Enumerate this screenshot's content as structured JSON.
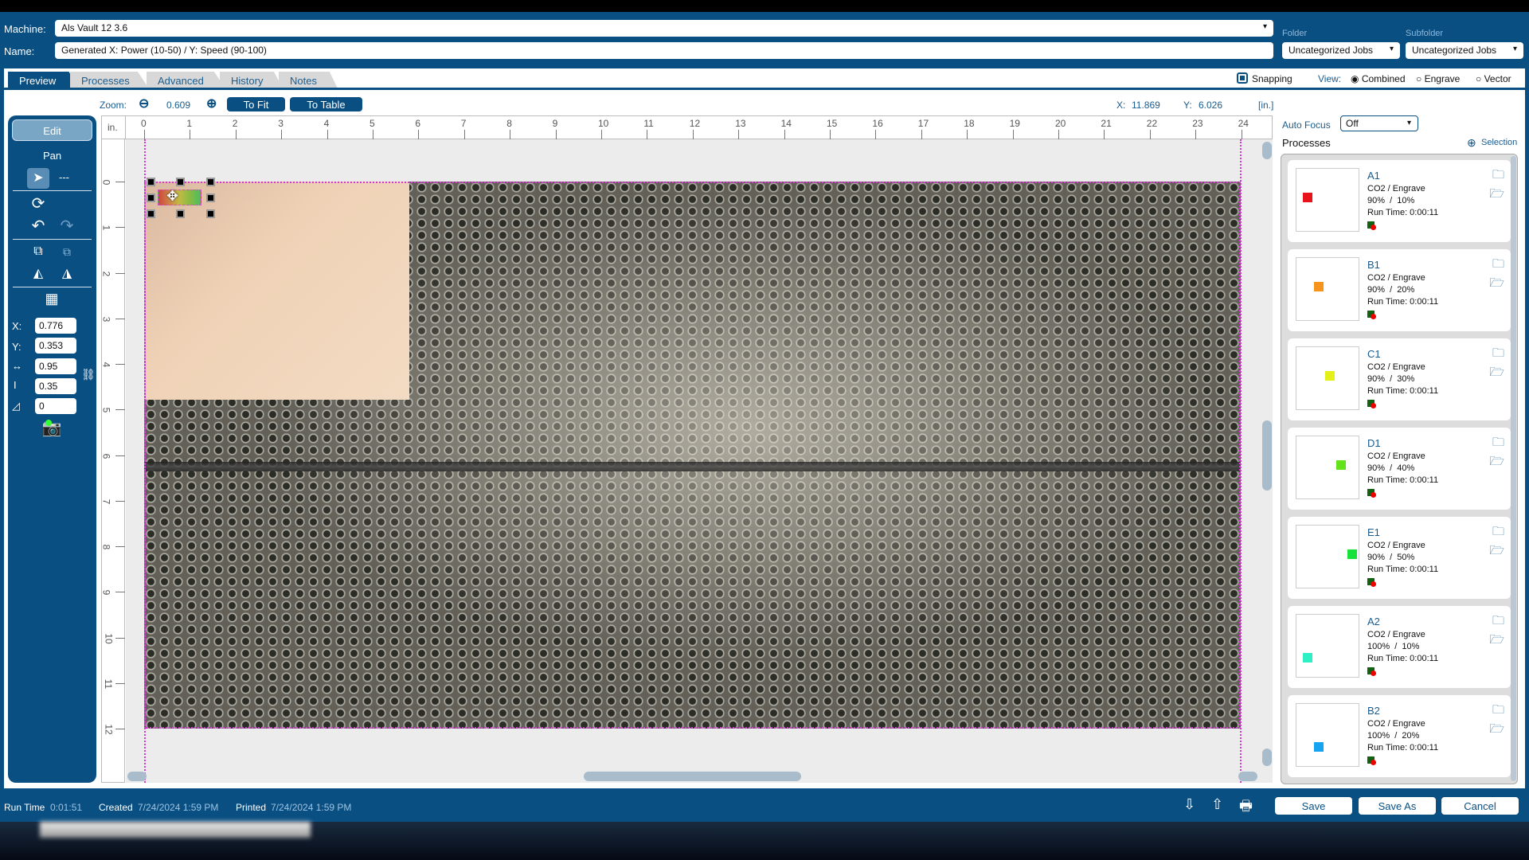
{
  "header": {
    "machine_label": "Machine:",
    "machine_value": "Als Vault 12 3.6",
    "name_label": "Name:",
    "name_value": "Generated X: Power (10-50) / Y: Speed (90-100)",
    "folder_label": "Folder",
    "folder_value": "Uncategorized Jobs",
    "subfolder_label": "Subfolder",
    "subfolder_value": "Uncategorized Jobs"
  },
  "tabs": [
    "Preview",
    "Processes",
    "Advanced",
    "History",
    "Notes"
  ],
  "view": {
    "snapping_label": "Snapping",
    "snapping_checked": true,
    "view_label": "View:",
    "options": [
      "Combined",
      "Engrave",
      "Vector"
    ],
    "selected": "Combined"
  },
  "zoom": {
    "label": "Zoom:",
    "value": "0.609",
    "to_fit": "To Fit",
    "to_table": "To Table"
  },
  "cursor": {
    "x_label": "X:",
    "x": "11.869",
    "y_label": "Y:",
    "y": "6.026",
    "unit": "[in.]"
  },
  "toolbar": {
    "edit": "Edit",
    "pan": "Pan",
    "dash": "---",
    "x_label": "X:",
    "x": "0.776",
    "y_label": "Y:",
    "y": "0.353",
    "width": "0.95",
    "height": "0.35",
    "angle": "0"
  },
  "ruler": {
    "unit": "in.",
    "x_labels": [
      "0",
      "1",
      "2",
      "3",
      "4",
      "5",
      "6",
      "7",
      "8",
      "9",
      "10",
      "11",
      "12",
      "13",
      "14",
      "15",
      "16",
      "17",
      "18",
      "19",
      "20",
      "21",
      "22",
      "23",
      "24"
    ],
    "y_labels": [
      "0",
      "1",
      "2",
      "3",
      "4",
      "5",
      "6",
      "7",
      "8",
      "9",
      "10",
      "11",
      "12"
    ]
  },
  "right": {
    "autofocus_label": "Auto Focus",
    "autofocus_value": "Off",
    "processes_label": "Processes",
    "selection_label": "Selection"
  },
  "processes": [
    {
      "name": "A1",
      "type": "CO2 / Engrave",
      "settings": "90%  /  10%",
      "runtime": "Run Time: 0:00:11",
      "color": "#e8141c"
    },
    {
      "name": "B1",
      "type": "CO2 / Engrave",
      "settings": "90%  /  20%",
      "runtime": "Run Time: 0:00:11",
      "color": "#f7941d"
    },
    {
      "name": "C1",
      "type": "CO2 / Engrave",
      "settings": "90%  /  30%",
      "runtime": "Run Time: 0:00:11",
      "color": "#e3f01a"
    },
    {
      "name": "D1",
      "type": "CO2 / Engrave",
      "settings": "90%  /  40%",
      "runtime": "Run Time: 0:00:11",
      "color": "#66e21a"
    },
    {
      "name": "E1",
      "type": "CO2 / Engrave",
      "settings": "90%  /  50%",
      "runtime": "Run Time: 0:00:11",
      "color": "#16e23a"
    },
    {
      "name": "A2",
      "type": "CO2 / Engrave",
      "settings": "100%  /  10%",
      "runtime": "Run Time: 0:00:11",
      "color": "#2ef0c4"
    },
    {
      "name": "B2",
      "type": "CO2 / Engrave",
      "settings": "100%  /  20%",
      "runtime": "Run Time: 0:00:11",
      "color": "#16a4f2"
    }
  ],
  "footer": {
    "runtime_label": "Run Time",
    "runtime": "0:01:51",
    "created_label": "Created",
    "created": "7/24/2024 1:59 PM",
    "printed_label": "Printed",
    "printed": "7/24/2024 1:59 PM",
    "save": "Save",
    "save_as": "Save As",
    "cancel": "Cancel"
  }
}
